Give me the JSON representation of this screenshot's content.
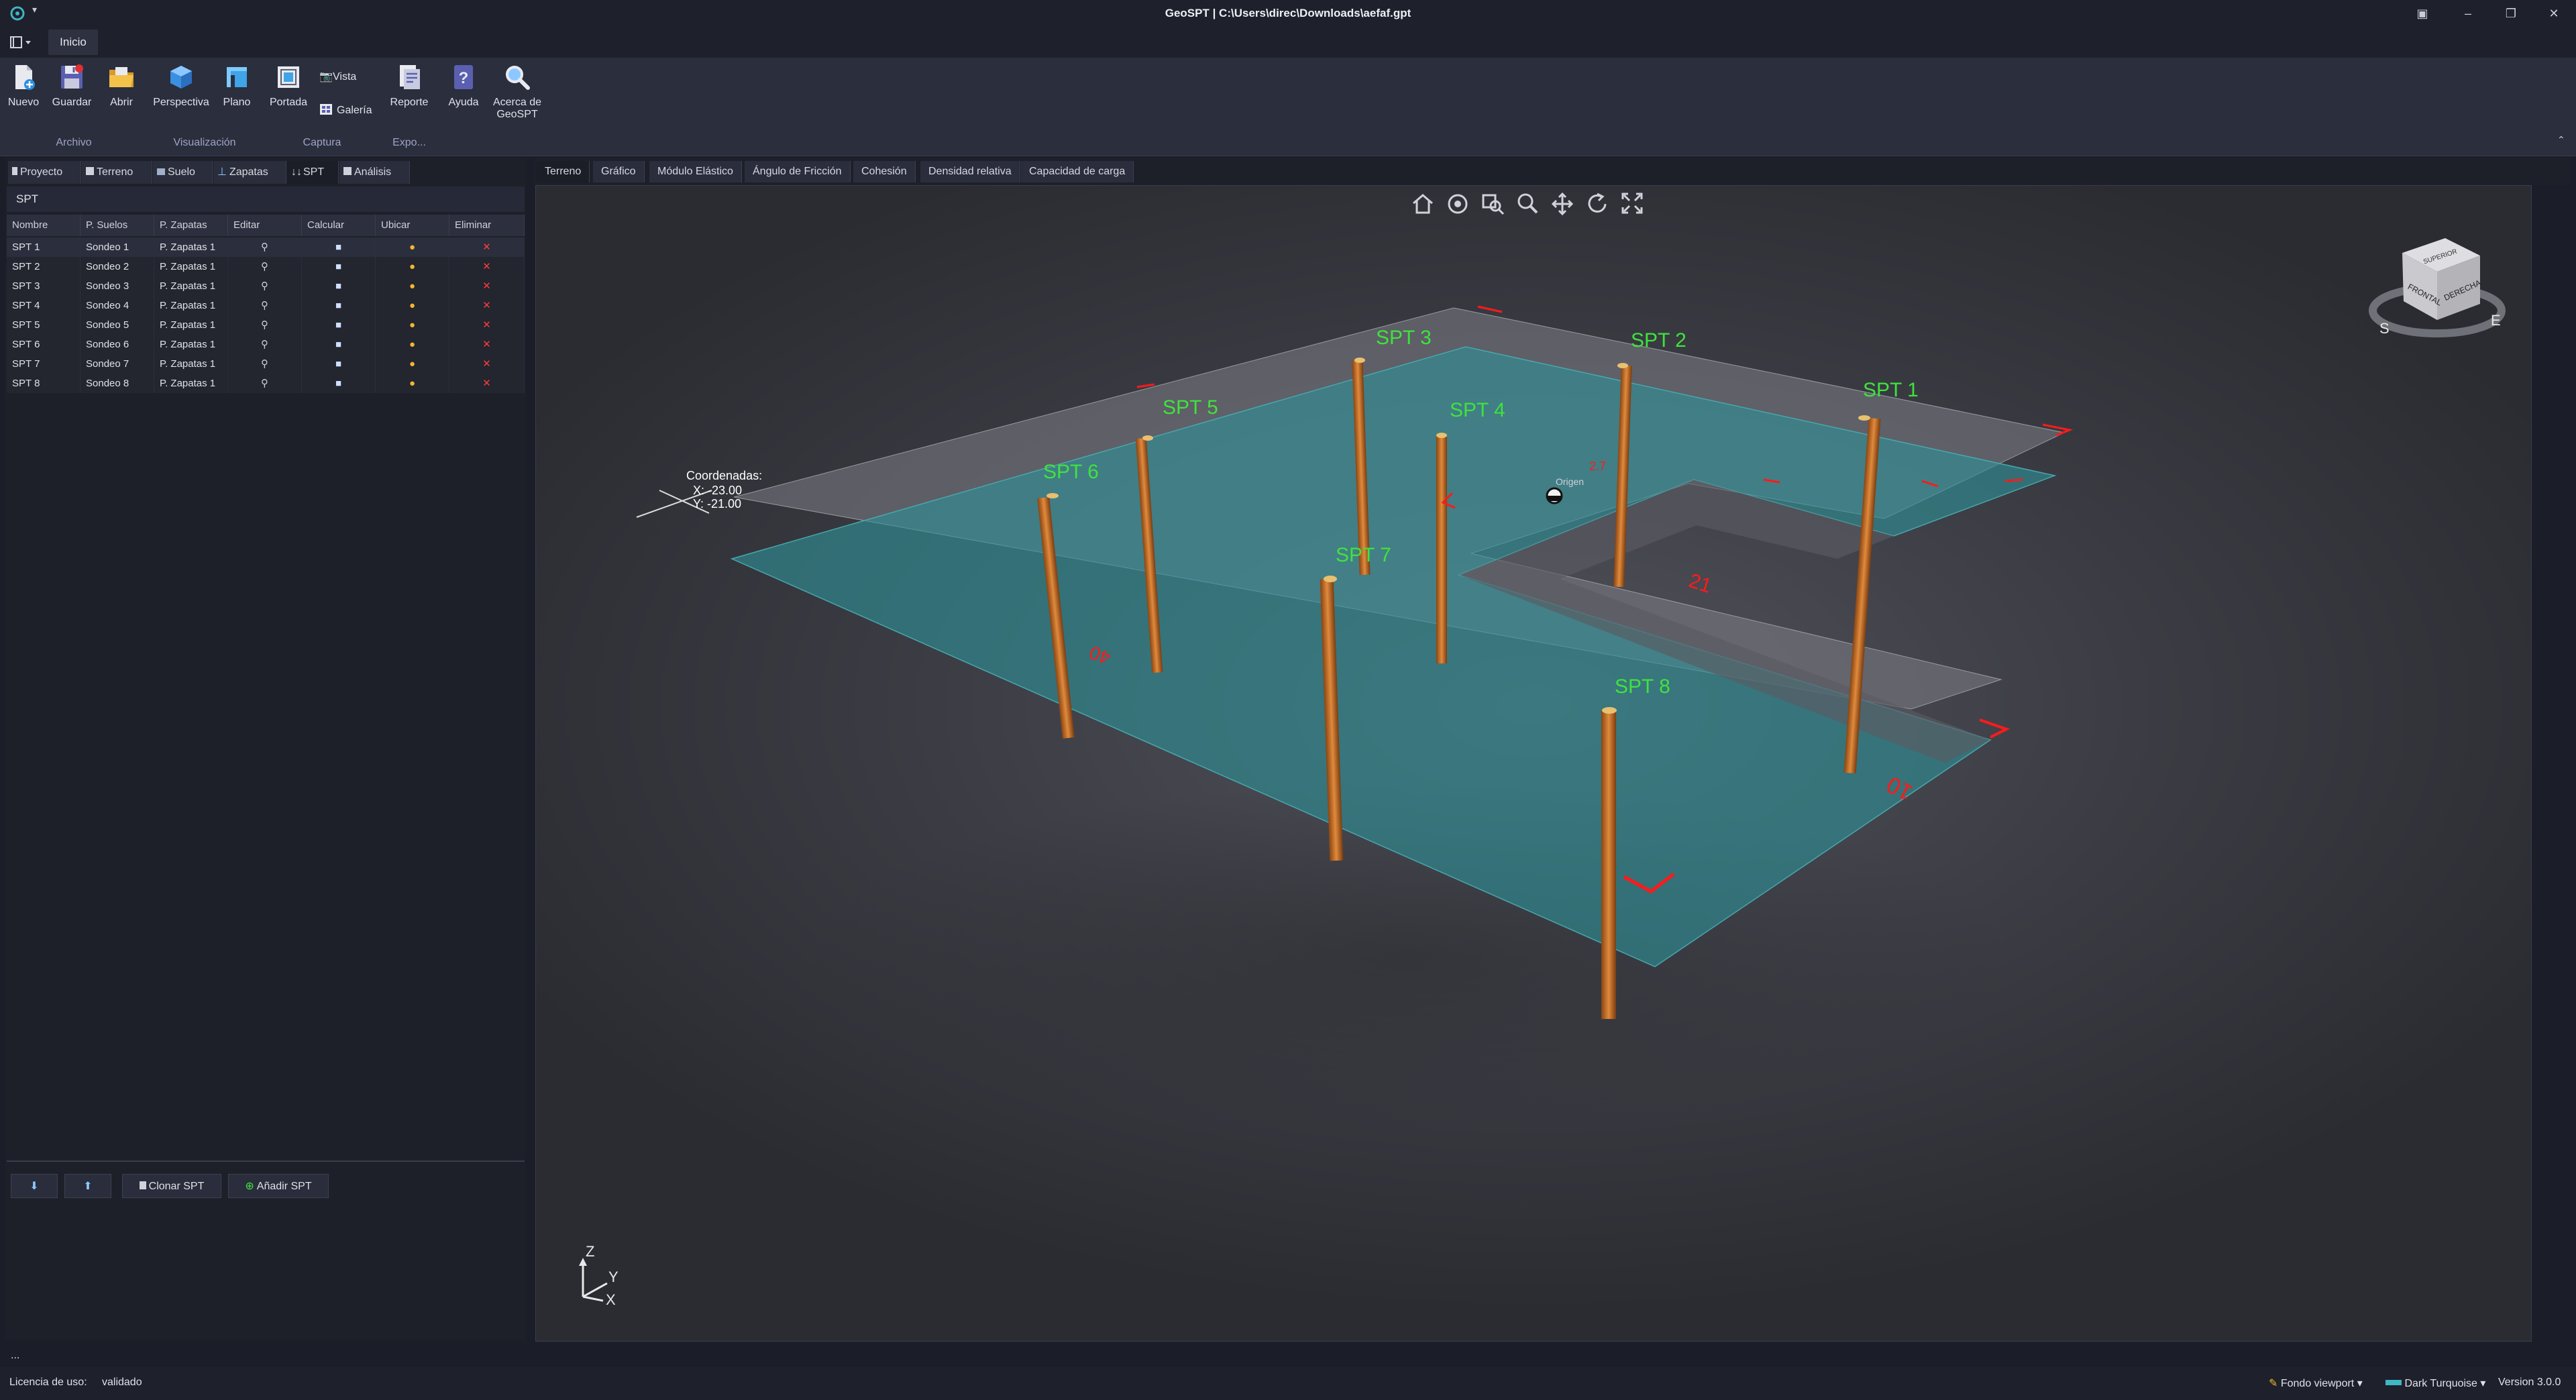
{
  "window": {
    "title": "GeoSPT | C:\\Users\\direc\\Downloads\\aefaf.gpt"
  },
  "menu": {
    "tab": "Inicio"
  },
  "ribbon": {
    "buttons": {
      "nuevo": "Nuevo",
      "guardar": "Guardar",
      "abrir": "Abrir",
      "perspectiva": "Perspectiva",
      "plano": "Plano",
      "portada": "Portada",
      "vista": "Vista",
      "galeria": "Galería",
      "reporte": "Reporte",
      "ayuda": "Ayuda",
      "acerca_l1": "Acerca de",
      "acerca_l2": "GeoSPT"
    },
    "groups": {
      "archivo": "Archivo",
      "visualizacion": "Visualización",
      "captura": "Captura",
      "expo": "Expo..."
    }
  },
  "left_tabs": [
    "Proyecto",
    "Terreno",
    "Suelo",
    "Zapatas",
    "SPT",
    "Análisis"
  ],
  "spt_section": "SPT",
  "table": {
    "columns": [
      "Nombre",
      "P. Suelos",
      "P. Zapatas",
      "Editar",
      "Calcular",
      "Ubicar",
      "Eliminar"
    ],
    "rows": [
      {
        "nombre": "SPT 1",
        "suelos": "Sondeo 1",
        "zapatas": "P. Zapatas 1"
      },
      {
        "nombre": "SPT 2",
        "suelos": "Sondeo 2",
        "zapatas": "P. Zapatas 1"
      },
      {
        "nombre": "SPT 3",
        "suelos": "Sondeo 3",
        "zapatas": "P. Zapatas 1"
      },
      {
        "nombre": "SPT 4",
        "suelos": "Sondeo 4",
        "zapatas": "P. Zapatas 1"
      },
      {
        "nombre": "SPT 5",
        "suelos": "Sondeo 5",
        "zapatas": "P. Zapatas 1"
      },
      {
        "nombre": "SPT 6",
        "suelos": "Sondeo 6",
        "zapatas": "P. Zapatas 1"
      },
      {
        "nombre": "SPT 7",
        "suelos": "Sondeo 7",
        "zapatas": "P. Zapatas 1"
      },
      {
        "nombre": "SPT 8",
        "suelos": "Sondeo 8",
        "zapatas": "P. Zapatas 1"
      }
    ]
  },
  "left_buttons": {
    "clonar": "Clonar SPT",
    "anadir": "Añadir SPT"
  },
  "viewport_tabs": [
    "Terreno",
    "Gráfico",
    "Módulo Elástico",
    "Ángulo de Fricción",
    "Cohesión",
    "Densidad relativa",
    "Capacidad de carga"
  ],
  "viewport": {
    "coords_title": "Coordenadas:",
    "coord_x": "X: -23.00",
    "coord_y": "Y: -21.00",
    "origin": "Origen",
    "boreholes": [
      "SPT 1",
      "SPT 2",
      "SPT 3",
      "SPT 4",
      "SPT 5",
      "SPT 6",
      "SPT 7",
      "SPT 8"
    ],
    "dims": [
      "21",
      "10",
      "40",
      "2.7"
    ],
    "axes": {
      "z": "Z",
      "y": "Y",
      "x": "X"
    },
    "cube": {
      "top": "SUPERIOR",
      "front": "FRONTAL",
      "right": "DERECHA",
      "s": "S",
      "e": "E"
    },
    "colors": {
      "label": "#3fe23f",
      "plate": "#2f8f96",
      "pile": "#c86a1e",
      "dim": "#ff1a1a"
    }
  },
  "status": {
    "dots": "...",
    "licencia_label": "Licencia de uso:",
    "licencia_value": "validado",
    "fondo": "Fondo viewport",
    "theme": "Dark Turquoise",
    "version": "Version 3.0.0"
  }
}
